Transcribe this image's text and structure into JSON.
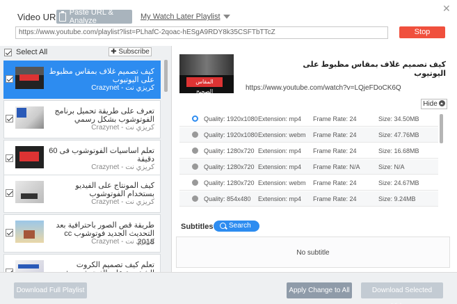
{
  "header": {
    "url_label": "Video URL:",
    "paste_button": "Paste URL & Analyze",
    "watch_later": "My Watch Later Playlist",
    "close": "✕",
    "url_value": "https://www.youtube.com/playlist?list=PLhafC-2qoac-hESgA9RDY8k35CSFTbTTcZ",
    "stop_button": "Stop"
  },
  "playlist": {
    "select_all": "Select All",
    "subscribe": "✚ Subscribe",
    "items": [
      {
        "title": "كيف تصميم غلاف بمقاس مظبوط على اليوتيوب",
        "channel": "كريزي نت - Crazynet",
        "checked": true,
        "active": true
      },
      {
        "title": "تعرف على طريقة تحميل برنامج الفوتوشوب بشكل رسمي",
        "channel": "كريزي نت - Crazynet",
        "checked": true,
        "active": false
      },
      {
        "title": "تعلم اساسيات الفوتوشوب فى 60 دقيقة",
        "channel": "كريزي نت - Crazynet",
        "checked": true,
        "active": false
      },
      {
        "title": "كيف المونتاج على الفيديو بستخدام الفوتوشوب",
        "channel": "كريزي نت - Crazynet",
        "checked": true,
        "active": false
      },
      {
        "title": "طريقة قص الصور باحترافية بعد التحديث الجديد فوتوشوب cc 2018",
        "channel": "كريزي نت - Crazynet",
        "checked": true,
        "active": false
      },
      {
        "title": "تعلم كيف تصميم الكروت الشخصية على الفوتوشوب + البحث عن الف",
        "channel": "",
        "checked": true,
        "active": false
      }
    ]
  },
  "video": {
    "thumb_text": "المقاس الصحيح",
    "title": "كيف تصميم غلاف بمقاس مظبوط على اليوتيوب",
    "url": "https://www.youtube.com/watch?v=LQjeFDoCK6Q",
    "hide_label": "Hide"
  },
  "qualities": [
    {
      "quality": "Quality: 1920x1080",
      "ext": "Extension: mp4",
      "rate": "Frame Rate: 24",
      "size": "Size: 34.50MB",
      "selected": true
    },
    {
      "quality": "Quality: 1920x1080",
      "ext": "Extension: webm",
      "rate": "Frame Rate: 24",
      "size": "Size: 47.76MB",
      "selected": false
    },
    {
      "quality": "Quality: 1280x720",
      "ext": "Extension: mp4",
      "rate": "Frame Rate: 24",
      "size": "Size: 16.68MB",
      "selected": false
    },
    {
      "quality": "Quality: 1280x720",
      "ext": "Extension: mp4",
      "rate": "Frame Rate: N/A",
      "size": "Size: N/A",
      "selected": false
    },
    {
      "quality": "Quality: 1280x720",
      "ext": "Extension: webm",
      "rate": "Frame Rate: 24",
      "size": "Size: 24.67MB",
      "selected": false
    },
    {
      "quality": "Quality: 854x480",
      "ext": "Extension: mp4",
      "rate": "Frame Rate: 24",
      "size": "Size: 9.24MB",
      "selected": false
    }
  ],
  "subtitles": {
    "label": "Subtitles",
    "search": "Search",
    "empty": "No subtitle"
  },
  "footer": {
    "download_playlist": "Download Full Playlist",
    "apply_all": "Apply Change to All",
    "download_selected": "Download Selected Videos"
  }
}
